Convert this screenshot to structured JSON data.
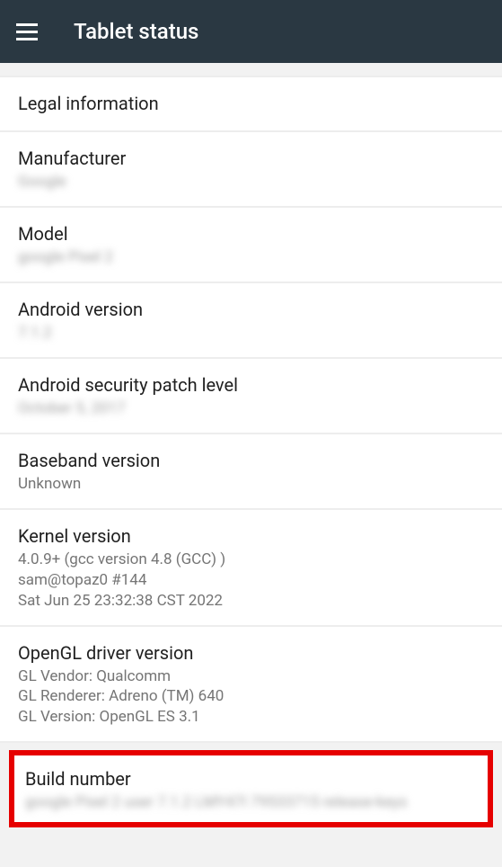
{
  "header": {
    "title": "Tablet status"
  },
  "items": {
    "legal": {
      "title": "Legal information"
    },
    "manufacturer": {
      "title": "Manufacturer",
      "value": "Google"
    },
    "model": {
      "title": "Model",
      "value": "google Pixel 2"
    },
    "android_version": {
      "title": "Android version",
      "value": "7.1.2"
    },
    "security_patch": {
      "title": "Android security patch level",
      "value": "October 5, 2017"
    },
    "baseband": {
      "title": "Baseband version",
      "value": "Unknown"
    },
    "kernel": {
      "title": "Kernel version",
      "value": "4.0.9+ (gcc version 4.8 (GCC) )\nsam@topaz0 #144\nSat Jun 25 23:32:38 CST 2022"
    },
    "opengl": {
      "title": "OpenGL driver version",
      "value": "GL Vendor: Qualcomm\nGL Renderer: Adreno (TM) 640\nGL Version: OpenGL ES 3.1"
    },
    "build": {
      "title": "Build number",
      "value": "google Pixel 2 user 7.1.2 LMY47I 79533715 release-keys"
    }
  }
}
